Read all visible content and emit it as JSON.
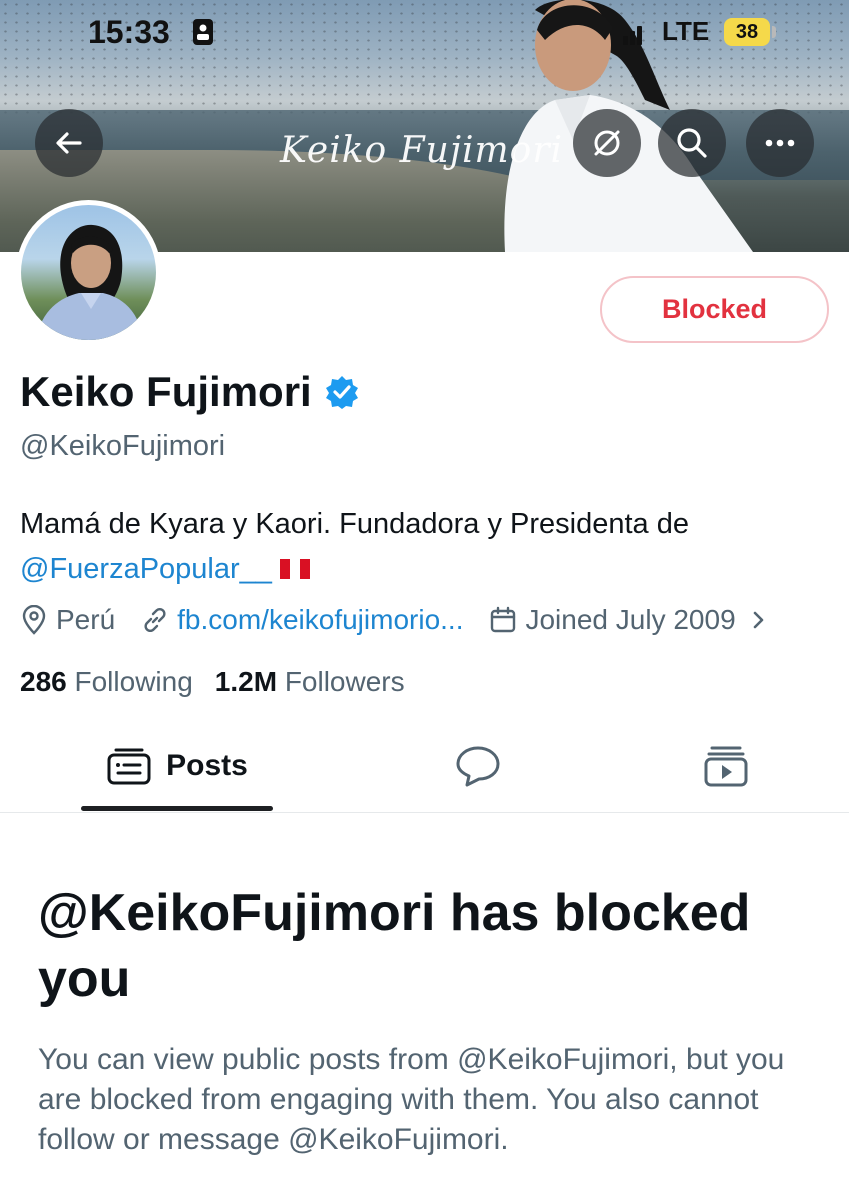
{
  "status_bar": {
    "time": "15:33",
    "network": "LTE",
    "battery": "38"
  },
  "header": {
    "back_icon": "arrow-left-icon",
    "translate_icon": "slash-circle-icon",
    "search_icon": "search-icon",
    "more_icon": "more-horizontal-icon",
    "banner_signature": "Keiko Fujimori"
  },
  "profile": {
    "name": "Keiko Fujimori",
    "verified_icon": "verified-badge-icon",
    "handle": "@KeikoFujimori",
    "blocked_label": "Blocked",
    "bio_text": "Mamá de Kyara y Kaori. Fundadora y Presidenta de",
    "bio_link": "@FuerzaPopular__",
    "location": "Perú",
    "website": "fb.com/keikofujimorio...",
    "joined": "Joined July 2009",
    "following_count": "286",
    "following_label": "Following",
    "followers_count": "1.2M",
    "followers_label": "Followers"
  },
  "tabs": {
    "posts_label": "Posts"
  },
  "blocked_notice": {
    "title": "@KeikoFujimori has blocked you",
    "description": "You can view public posts from @KeikoFujimori, but you are blocked from engaging with them. You also cannot follow or message @KeikoFujimori."
  },
  "colors": {
    "accent_link": "#1d85d0",
    "blocked_red": "#e2323f",
    "secondary_text": "#536471",
    "battery_yellow": "#f5d94a"
  }
}
